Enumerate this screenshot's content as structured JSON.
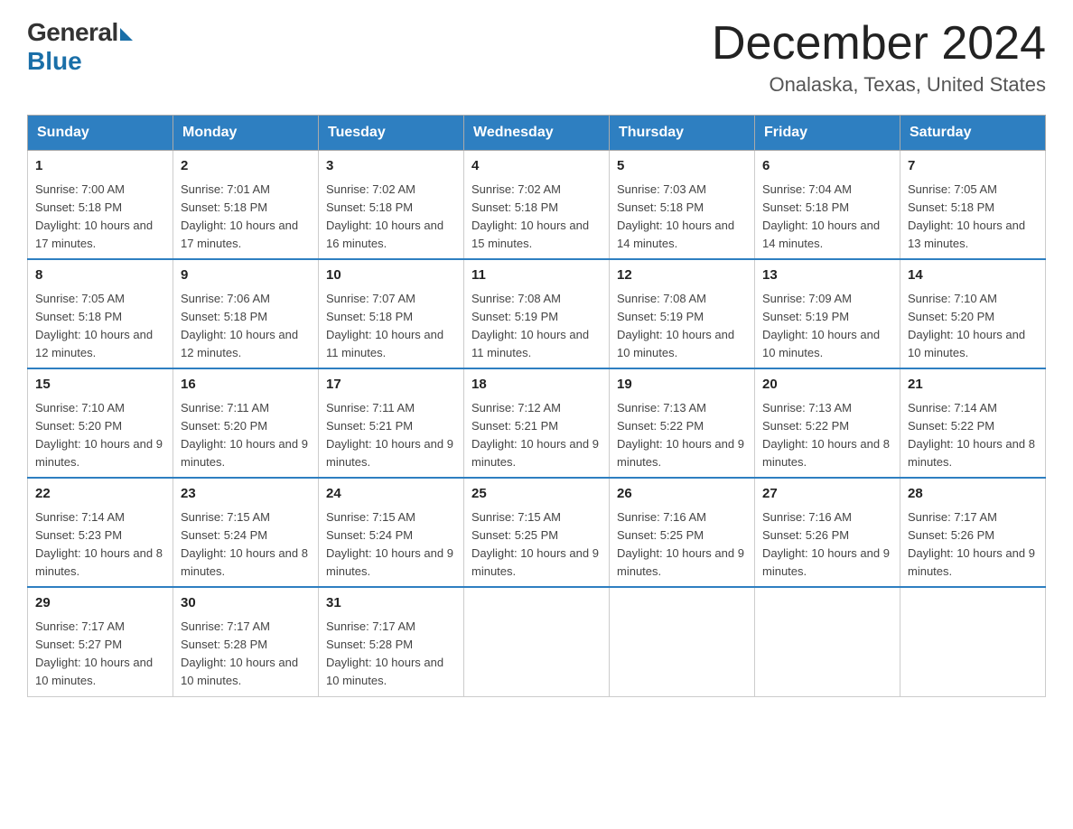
{
  "header": {
    "logo_general": "General",
    "logo_blue": "Blue",
    "month_title": "December 2024",
    "location": "Onalaska, Texas, United States"
  },
  "days_of_week": [
    "Sunday",
    "Monday",
    "Tuesday",
    "Wednesday",
    "Thursday",
    "Friday",
    "Saturday"
  ],
  "weeks": [
    [
      {
        "day": "1",
        "sunrise": "7:00 AM",
        "sunset": "5:18 PM",
        "daylight": "10 hours and 17 minutes."
      },
      {
        "day": "2",
        "sunrise": "7:01 AM",
        "sunset": "5:18 PM",
        "daylight": "10 hours and 17 minutes."
      },
      {
        "day": "3",
        "sunrise": "7:02 AM",
        "sunset": "5:18 PM",
        "daylight": "10 hours and 16 minutes."
      },
      {
        "day": "4",
        "sunrise": "7:02 AM",
        "sunset": "5:18 PM",
        "daylight": "10 hours and 15 minutes."
      },
      {
        "day": "5",
        "sunrise": "7:03 AM",
        "sunset": "5:18 PM",
        "daylight": "10 hours and 14 minutes."
      },
      {
        "day": "6",
        "sunrise": "7:04 AM",
        "sunset": "5:18 PM",
        "daylight": "10 hours and 14 minutes."
      },
      {
        "day": "7",
        "sunrise": "7:05 AM",
        "sunset": "5:18 PM",
        "daylight": "10 hours and 13 minutes."
      }
    ],
    [
      {
        "day": "8",
        "sunrise": "7:05 AM",
        "sunset": "5:18 PM",
        "daylight": "10 hours and 12 minutes."
      },
      {
        "day": "9",
        "sunrise": "7:06 AM",
        "sunset": "5:18 PM",
        "daylight": "10 hours and 12 minutes."
      },
      {
        "day": "10",
        "sunrise": "7:07 AM",
        "sunset": "5:18 PM",
        "daylight": "10 hours and 11 minutes."
      },
      {
        "day": "11",
        "sunrise": "7:08 AM",
        "sunset": "5:19 PM",
        "daylight": "10 hours and 11 minutes."
      },
      {
        "day": "12",
        "sunrise": "7:08 AM",
        "sunset": "5:19 PM",
        "daylight": "10 hours and 10 minutes."
      },
      {
        "day": "13",
        "sunrise": "7:09 AM",
        "sunset": "5:19 PM",
        "daylight": "10 hours and 10 minutes."
      },
      {
        "day": "14",
        "sunrise": "7:10 AM",
        "sunset": "5:20 PM",
        "daylight": "10 hours and 10 minutes."
      }
    ],
    [
      {
        "day": "15",
        "sunrise": "7:10 AM",
        "sunset": "5:20 PM",
        "daylight": "10 hours and 9 minutes."
      },
      {
        "day": "16",
        "sunrise": "7:11 AM",
        "sunset": "5:20 PM",
        "daylight": "10 hours and 9 minutes."
      },
      {
        "day": "17",
        "sunrise": "7:11 AM",
        "sunset": "5:21 PM",
        "daylight": "10 hours and 9 minutes."
      },
      {
        "day": "18",
        "sunrise": "7:12 AM",
        "sunset": "5:21 PM",
        "daylight": "10 hours and 9 minutes."
      },
      {
        "day": "19",
        "sunrise": "7:13 AM",
        "sunset": "5:22 PM",
        "daylight": "10 hours and 9 minutes."
      },
      {
        "day": "20",
        "sunrise": "7:13 AM",
        "sunset": "5:22 PM",
        "daylight": "10 hours and 8 minutes."
      },
      {
        "day": "21",
        "sunrise": "7:14 AM",
        "sunset": "5:22 PM",
        "daylight": "10 hours and 8 minutes."
      }
    ],
    [
      {
        "day": "22",
        "sunrise": "7:14 AM",
        "sunset": "5:23 PM",
        "daylight": "10 hours and 8 minutes."
      },
      {
        "day": "23",
        "sunrise": "7:15 AM",
        "sunset": "5:24 PM",
        "daylight": "10 hours and 8 minutes."
      },
      {
        "day": "24",
        "sunrise": "7:15 AM",
        "sunset": "5:24 PM",
        "daylight": "10 hours and 9 minutes."
      },
      {
        "day": "25",
        "sunrise": "7:15 AM",
        "sunset": "5:25 PM",
        "daylight": "10 hours and 9 minutes."
      },
      {
        "day": "26",
        "sunrise": "7:16 AM",
        "sunset": "5:25 PM",
        "daylight": "10 hours and 9 minutes."
      },
      {
        "day": "27",
        "sunrise": "7:16 AM",
        "sunset": "5:26 PM",
        "daylight": "10 hours and 9 minutes."
      },
      {
        "day": "28",
        "sunrise": "7:17 AM",
        "sunset": "5:26 PM",
        "daylight": "10 hours and 9 minutes."
      }
    ],
    [
      {
        "day": "29",
        "sunrise": "7:17 AM",
        "sunset": "5:27 PM",
        "daylight": "10 hours and 10 minutes."
      },
      {
        "day": "30",
        "sunrise": "7:17 AM",
        "sunset": "5:28 PM",
        "daylight": "10 hours and 10 minutes."
      },
      {
        "day": "31",
        "sunrise": "7:17 AM",
        "sunset": "5:28 PM",
        "daylight": "10 hours and 10 minutes."
      },
      null,
      null,
      null,
      null
    ]
  ],
  "labels": {
    "sunrise": "Sunrise:",
    "sunset": "Sunset:",
    "daylight": "Daylight:"
  }
}
